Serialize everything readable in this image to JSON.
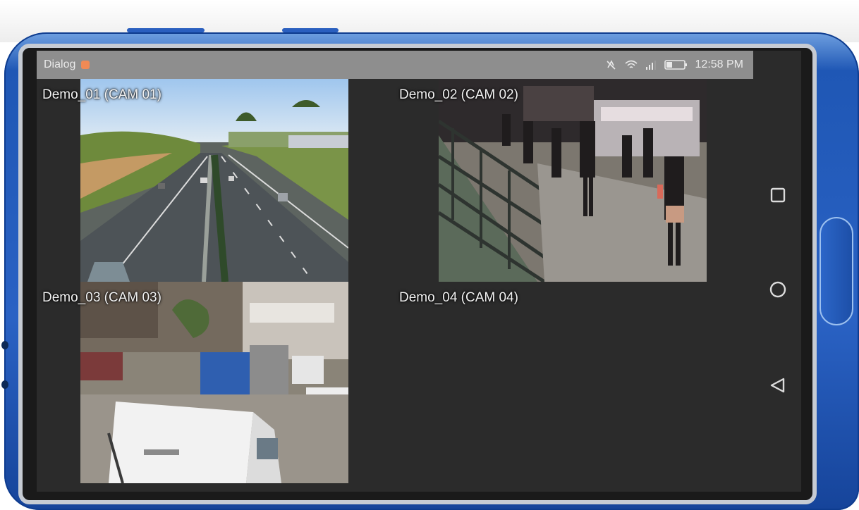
{
  "statusbar": {
    "app_name": "Dialog",
    "time": "12:58 PM",
    "icons": [
      "notification-icon",
      "mute-icon",
      "wifi-icon",
      "signal-icon",
      "battery-icon"
    ]
  },
  "cameras": [
    {
      "label": "Demo_01 (CAM 01)",
      "feed": "highway traffic"
    },
    {
      "label": "Demo_02 (CAM 02)",
      "feed": "crowded street stairs"
    },
    {
      "label": "Demo_03 (CAM 03)",
      "feed": "street with trucks"
    },
    {
      "label": "Demo_04 (CAM 04)",
      "feed": "no feed"
    }
  ],
  "navigation": {
    "buttons": [
      "recents-square-icon",
      "home-circle-icon",
      "back-triangle-icon"
    ]
  },
  "colors": {
    "phone_body": "#2a62c4",
    "screen_bg": "#2b2b2b",
    "statusbar_bg": "#8e8e8e"
  }
}
